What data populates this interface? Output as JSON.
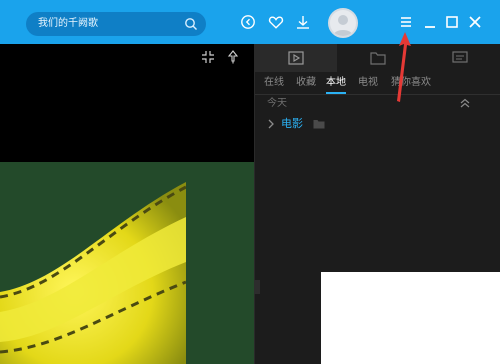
{
  "topbar": {
    "search_placeholder": "我们的千阙歌",
    "icons": [
      "search-icon",
      "history-icon",
      "heart-icon",
      "download-icon",
      "avatar",
      "menu-icon",
      "minimize-icon",
      "maximize-icon",
      "close-icon"
    ]
  },
  "video": {
    "controls": [
      "fullscreen-exit-icon",
      "pin-icon"
    ]
  },
  "panel": {
    "tabs": [
      "play-list-tab",
      "folder-tab",
      "chat-tab"
    ],
    "subtabs": [
      "在线",
      "收藏",
      "本地",
      "电视",
      "猜你喜欢"
    ],
    "active_subtab": "本地",
    "section_label": "今天",
    "folder_label": "电影"
  },
  "colors": {
    "accent": "#1aa3ec",
    "link": "#2bb1f3",
    "panel_bg": "#1c1c1c",
    "annotation": "#e53935"
  }
}
